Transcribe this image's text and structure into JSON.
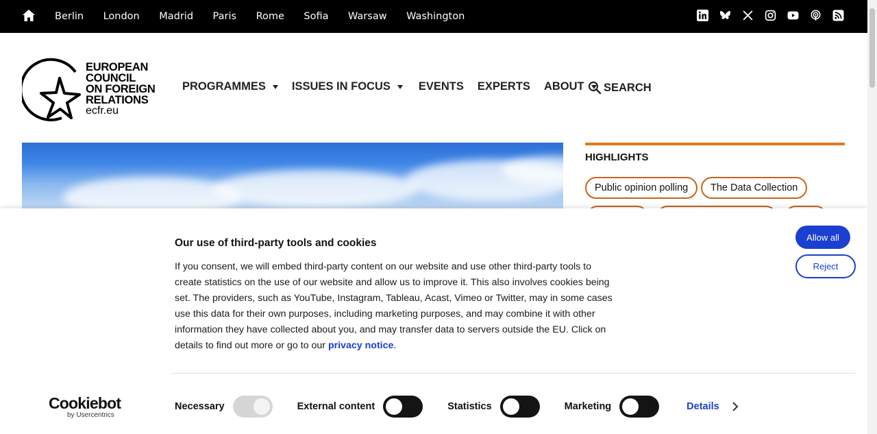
{
  "topbar": {
    "home_icon": "home-icon",
    "cities": [
      "Berlin",
      "London",
      "Madrid",
      "Paris",
      "Rome",
      "Sofia",
      "Warsaw",
      "Washington"
    ],
    "social_icons": [
      "linkedin-icon",
      "bluesky-icon",
      "x-icon",
      "instagram-icon",
      "youtube-icon",
      "podcast-icon",
      "rss-icon"
    ]
  },
  "logo": {
    "line1": "EUROPEAN",
    "line2": "COUNCIL",
    "line3": "ON FOREIGN",
    "line4": "RELATIONS",
    "url": "ecfr.eu"
  },
  "nav": {
    "programmes": "PROGRAMMES",
    "issues": "ISSUES IN FOCUS",
    "events": "EVENTS",
    "experts": "EXPERTS",
    "about": "ABOUT",
    "search": "SEARCH"
  },
  "highlights": {
    "title": "HIGHLIGHTS",
    "pills": [
      "Public opinion polling",
      "The Data Collection"
    ]
  },
  "cookie": {
    "title": "Our use of third-party tools and cookies",
    "body": "If you consent, we will embed third-party content on our website and use other third-party tools to create statistics on the use of our website and allow us to improve it. This also involves cookies being set. The providers, such as YouTube, Instagram, Tableau, Acast, Vimeo  or Twitter, may in some cases use this data for their own purposes, including marketing purposes, and may combine it with other information they have collected about you, and may transfer data to servers outside the EU. Click on details to find out more or go to our ",
    "privacy_link": "privacy notice",
    "body_end": ".",
    "allow_all": "Allow all",
    "reject": "Reject",
    "brand": "Cookiebot",
    "brand_sub": "by Usercentrics",
    "toggles": {
      "necessary": "Necessary",
      "external": "External content",
      "statistics": "Statistics",
      "marketing": "Marketing"
    },
    "details": "Details"
  },
  "colors": {
    "accent_blue": "#1a3fd1",
    "highlight_orange": "#e0781f",
    "topbar_bg": "#000000"
  }
}
